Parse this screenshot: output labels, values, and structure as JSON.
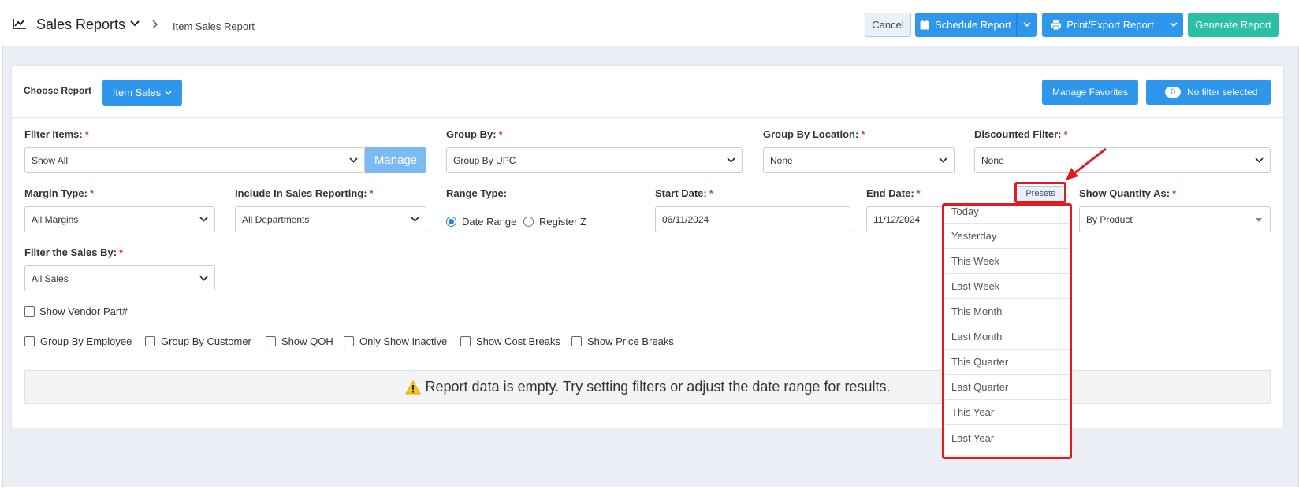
{
  "header": {
    "title": "Sales Reports",
    "breadcrumb": "Item Sales Report",
    "cancel_label": "Cancel",
    "schedule_label": "Schedule Report",
    "print_label": "Print/Export Report",
    "generate_label": "Generate Report"
  },
  "toolbar": {
    "choose_report_label": "Choose Report",
    "report_selected": "Item Sales",
    "manage_favorites_label": "Manage Favorites",
    "filter_badge_count": "0",
    "filter_status": "No filter selected"
  },
  "filters": {
    "filter_items": {
      "label": "Filter Items:",
      "value": "Show All",
      "manage_label": "Manage"
    },
    "group_by": {
      "label": "Group By:",
      "value": "Group By UPC"
    },
    "group_by_location": {
      "label": "Group By Location:",
      "value": "None"
    },
    "discounted_filter": {
      "label": "Discounted Filter:",
      "value": "None"
    },
    "margin_type": {
      "label": "Margin Type:",
      "value": "All Margins"
    },
    "include_in_sales": {
      "label": "Include In Sales Reporting:",
      "value": "All Departments"
    },
    "range_type": {
      "label": "Range Type:",
      "option_date": "Date Range",
      "option_register": "Register Z"
    },
    "start_date": {
      "label": "Start Date:",
      "value": "06/11/2024"
    },
    "end_date": {
      "label": "End Date:",
      "value": "11/12/2024"
    },
    "presets_label": "Presets",
    "show_quantity": {
      "label": "Show Quantity As:",
      "value": "By Product"
    },
    "filter_sales_by": {
      "label": "Filter the Sales By:",
      "value": "All Sales"
    },
    "required_mark": "*"
  },
  "checkboxes": {
    "vendor_part": "Show Vendor Part#",
    "group_employee": "Group By Employee",
    "group_customer": "Group By Customer",
    "show_qoh": "Show QOH",
    "only_inactive": "Only Show Inactive",
    "cost_breaks": "Show Cost Breaks",
    "price_breaks": "Show Price Breaks"
  },
  "presets": [
    "Today",
    "Yesterday",
    "This Week",
    "Last Week",
    "This Month",
    "Last Month",
    "This Quarter",
    "Last Quarter",
    "This Year",
    "Last Year"
  ],
  "alert": {
    "message": "Report data is empty. Try setting filters or adjust the date range for results."
  },
  "colors": {
    "primary": "#2f97eb",
    "success": "#2bbfa4",
    "highlight": "#e11b22",
    "required": "#e0343d"
  }
}
